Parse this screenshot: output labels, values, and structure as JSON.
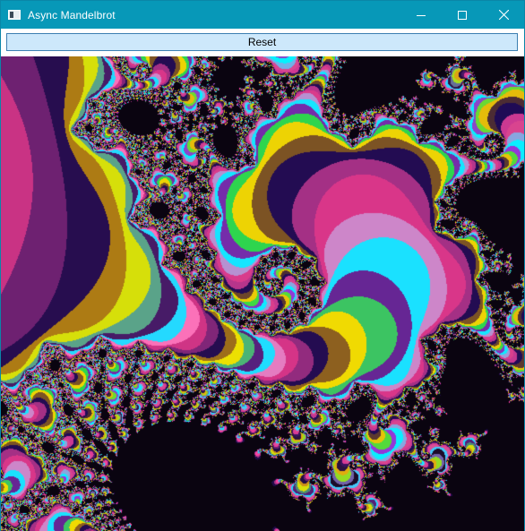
{
  "window": {
    "title": "Async Mandelbrot",
    "icon": "app-window-icon",
    "controls": {
      "minimize_icon": "minimize-icon",
      "maximize_icon": "maximize-icon",
      "close_icon": "close-icon"
    }
  },
  "toolbar": {
    "reset_label": "Reset"
  },
  "colors": {
    "titlebar": "#0798b8",
    "button_fill": "#cde8fb",
    "button_border": "#3c7fb1",
    "palette": [
      "#00f6ff",
      "#2fd0ff",
      "#ff6fb8",
      "#ff3ea0",
      "#c2388f",
      "#1e0b55",
      "#2a0e4d",
      "#d89a14",
      "#f2e000",
      "#2bd84a",
      "#b042ff",
      "#0a0410"
    ]
  }
}
